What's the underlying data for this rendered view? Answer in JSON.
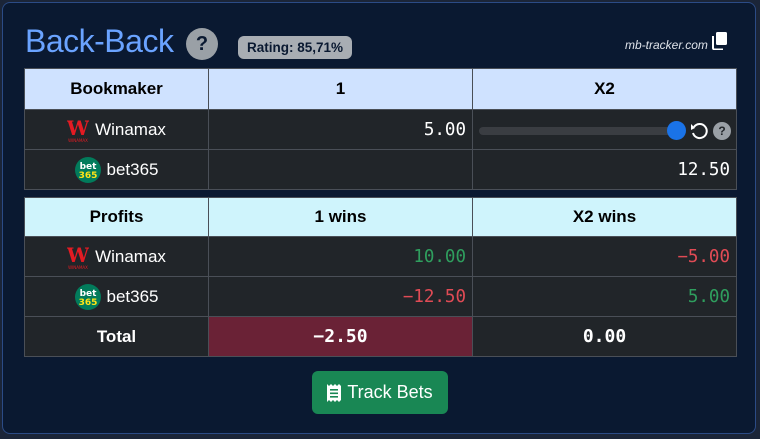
{
  "header": {
    "title": "Back-Back",
    "help": "?",
    "rating": "Rating: 85,71%",
    "site": "mb-tracker.com"
  },
  "odds_table": {
    "headers": [
      "Bookmaker",
      "1",
      "X2"
    ],
    "rows": [
      {
        "bookmaker": "Winamax",
        "odd_1": "5.00",
        "odd_x2": ""
      },
      {
        "bookmaker": "bet365",
        "odd_1": "",
        "odd_x2": "12.50"
      }
    ],
    "slider_help": "?"
  },
  "profits_table": {
    "headers": [
      "Profits",
      "1 wins",
      "X2 wins"
    ],
    "rows": [
      {
        "bookmaker": "Winamax",
        "win_1": "10.00",
        "win_x2": "−5.00"
      },
      {
        "bookmaker": "bet365",
        "win_1": "−12.50",
        "win_x2": "5.00"
      }
    ],
    "total": {
      "label": "Total",
      "win_1": "−2.50",
      "win_x2": "0.00"
    }
  },
  "actions": {
    "track_bets": "Track Bets"
  },
  "logos": {
    "winamax_mark": "W",
    "winamax_sub": "WINAMAX",
    "bet365_top": "bet",
    "bet365_bottom": "365"
  },
  "colors": {
    "profit_positive": "#2f9e5e",
    "profit_negative": "#e04b55",
    "primary_button": "#198754",
    "title": "#6aa3ff"
  }
}
